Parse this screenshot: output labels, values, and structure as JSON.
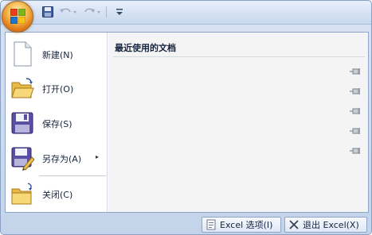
{
  "app": {
    "office_button_icon": "office-logo-icon"
  },
  "quick_access": {
    "save_icon": "save-icon",
    "undo_icon": "undo-icon",
    "redo_icon": "redo-icon",
    "customize_icon": "customize-dropdown-icon"
  },
  "menu": {
    "items": [
      {
        "label": "新建(N)",
        "icon": "new-document-icon"
      },
      {
        "label": "打开(O)",
        "icon": "open-folder-icon"
      },
      {
        "label": "保存(S)",
        "icon": "save-disk-icon"
      },
      {
        "label": "另存为(A)",
        "icon": "save-as-icon",
        "submenu_arrow": "▸"
      },
      {
        "label": "关闭(C)",
        "icon": "close-folder-icon"
      }
    ]
  },
  "recent": {
    "title": "最近使用的文档",
    "pin_icon": "pin-icon",
    "pin_count": 5
  },
  "bottom": {
    "options_label": "Excel 选项(I)",
    "exit_label": "退出 Excel(X)"
  },
  "colors": {
    "frame": "#c3d4ea",
    "border": "#8fa5c6",
    "recent_pane": "#f4f4f4"
  }
}
